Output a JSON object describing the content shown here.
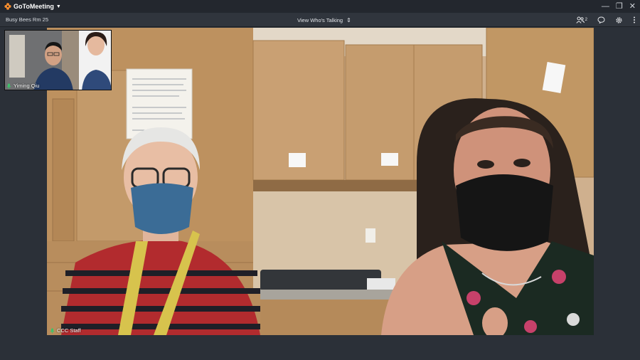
{
  "app": {
    "name": "GoToMeeting"
  },
  "toolbar": {
    "meeting_title": "Busy Bees Rm 25",
    "view_mode": "View Who's Talking",
    "attendee_count": "2"
  },
  "main_video": {
    "participant_name": "CCC Staff"
  },
  "thumbnail": {
    "participant_name": "Yiming Qiu"
  },
  "colors": {
    "titlebar": "#23272e",
    "toolbar": "#30353d",
    "stage_bg": "#2b3038",
    "mic_active": "#3cc46a",
    "brand_orange": "#f68d2e"
  },
  "icons": [
    "gotomeeting-logo-icon",
    "chevron-down-icon",
    "minimize-icon",
    "restore-icon",
    "close-icon",
    "updown-icon",
    "attendees-icon",
    "chat-icon",
    "gear-icon",
    "more-vertical-icon",
    "microphone-icon"
  ]
}
